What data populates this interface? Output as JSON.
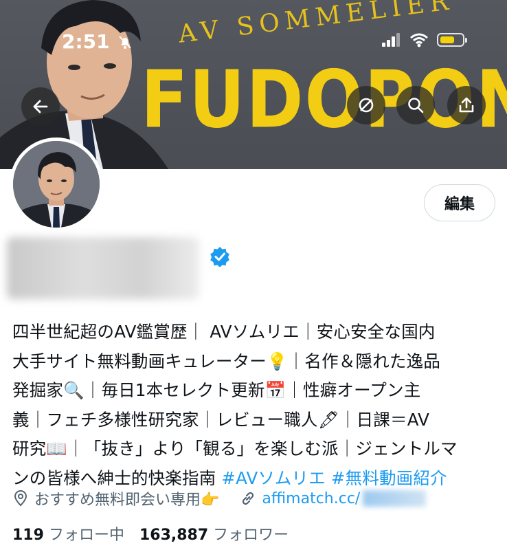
{
  "status_bar": {
    "time": "2:51",
    "icons": [
      "bell-slash-icon",
      "signal-icon",
      "wifi-icon",
      "battery-icon"
    ]
  },
  "banner": {
    "brand_sub": "AV SOMMELIER",
    "brand_main": "FUDOPON"
  },
  "top_actions": [
    "back-icon",
    "grok-icon",
    "search-icon",
    "share-icon"
  ],
  "profile": {
    "edit_label": "編集",
    "bio_lines": [
      "四半世紀超のAV鑑賞歴｜ AVソムリエ｜安心安全な国内",
      "大手サイト無料動画キュレーター💡｜名作＆隠れた逸品",
      "発掘家🔍｜毎日1本セレクト更新📅｜性癖オープン主",
      "義｜フェチ多様性研究家｜レビュー職人🖋｜日課＝AV",
      "研究📖｜「抜き」より「観る」を楽しむ派｜ジェントルマ"
    ],
    "bio_last_line": "ンの皆様へ紳士的快楽指南",
    "hashtags": [
      "#AVソムリエ",
      "#無料動画紹介"
    ],
    "location": "おすすめ無料即会い専用👉",
    "website": "affimatch.cc/",
    "following_count": "119",
    "following_label": "フォロー中",
    "followers_count": "163,887",
    "followers_label": "フォロワー"
  },
  "colors": {
    "accent": "#1d9bf0",
    "brand_yellow": "#f2cd14",
    "banner_bg": "#55585f"
  }
}
